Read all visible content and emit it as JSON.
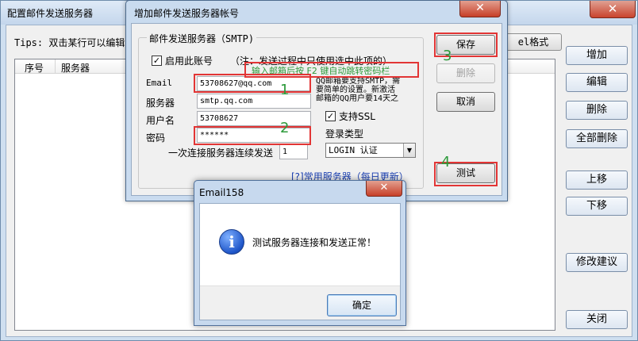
{
  "main_window": {
    "title": "配置邮件发送服务器",
    "close_glyph": "✕",
    "tips_left": "Tips: 双击某行可以编辑或",
    "format_button_label": "el格式",
    "list_columns": [
      "序号",
      "服务器"
    ],
    "side_buttons": [
      "增加",
      "编辑",
      "删除",
      "全部删除",
      "上移",
      "下移",
      "修改建议",
      "关闭"
    ]
  },
  "account_dialog": {
    "title": "增加邮件发送服务器帐号",
    "close_glyph": "✕",
    "group_title": "邮件发送服务器（SMTP)",
    "enable_checkbox": {
      "checked": true,
      "label": "启用此账号"
    },
    "enable_note": "（注：发送过程中只使用选中此项的）",
    "green_hint": "输入邮箱后按 F2 键自动跳转密码栏",
    "email": {
      "label": "Email",
      "value": "53708627@qq.com"
    },
    "server": {
      "label": "服务器",
      "value": "smtp.qq.com"
    },
    "username": {
      "label": "用户名",
      "value": "53708627"
    },
    "password": {
      "label": "密码",
      "value": "******"
    },
    "qq_note_lines": [
      "QQ邮箱要支持SMTP，需",
      "要简单的设置。新激活",
      "邮箱的QQ用户要14天之"
    ],
    "ssl_checkbox": {
      "checked": true,
      "label": "支持SSL"
    },
    "login_type": {
      "label": "登录类型",
      "selected": "LOGIN 认证"
    },
    "consecutive": {
      "label": "一次连接服务器连续发送",
      "value": "1"
    },
    "common_servers_link": "[?]常用服务器（每日更新）",
    "buttons": {
      "save": "保存",
      "delete": "删除",
      "cancel": "取消",
      "test": "测试"
    },
    "step_numbers": [
      "1",
      "2",
      "3",
      "4"
    ]
  },
  "message_box": {
    "title": "Email158",
    "close_glyph": "✕",
    "icon_glyph": "i",
    "message": "测试服务器连接和发送正常！",
    "ok_label": "确定"
  },
  "colors": {
    "highlight_red": "#e23535",
    "step_green": "#2c9a3a",
    "hint_green": "#2e9a3a",
    "link_blue": "#1a3fb0",
    "close_red": "#c73f28"
  }
}
